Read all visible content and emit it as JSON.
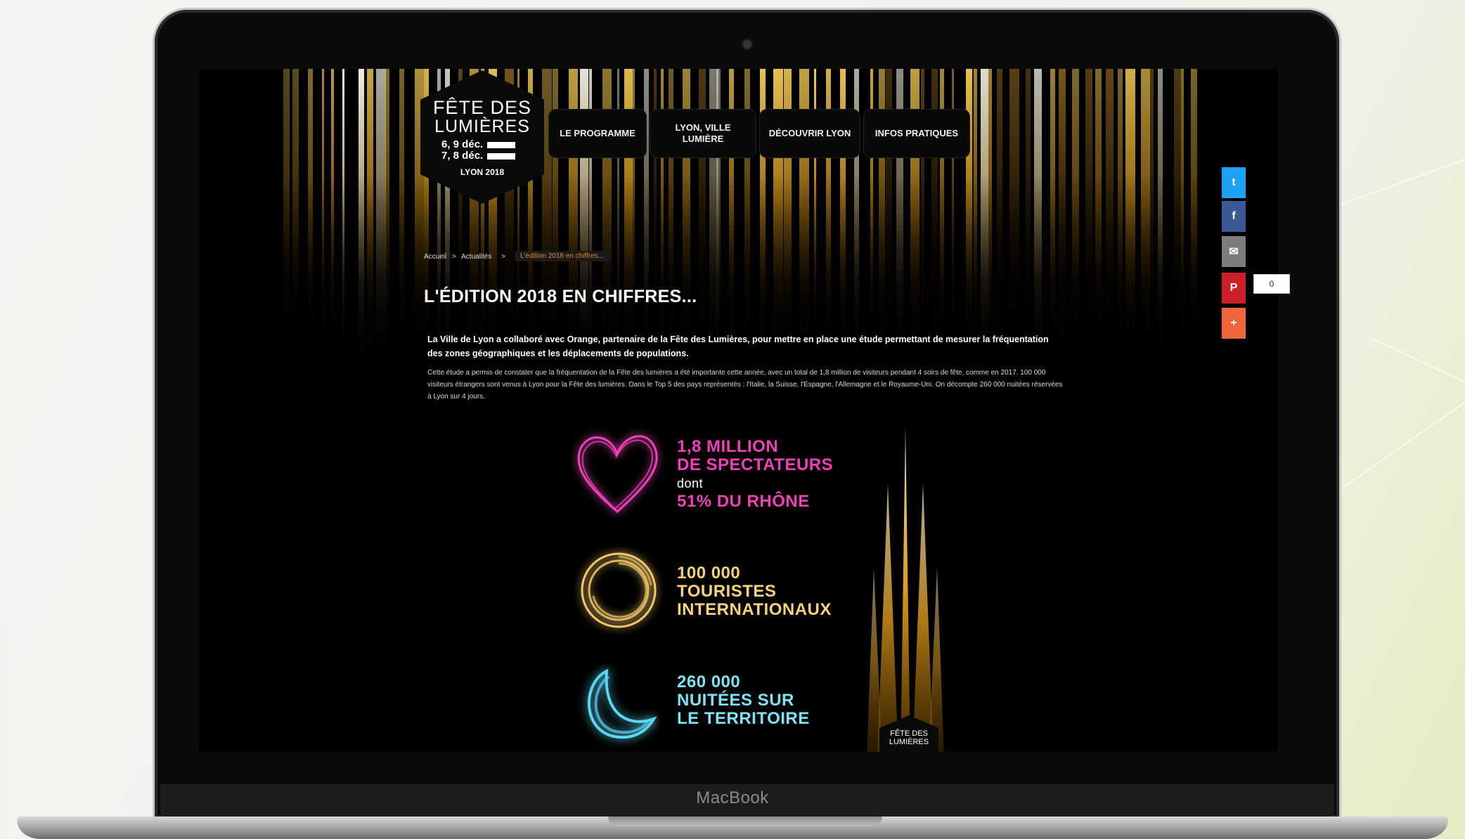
{
  "device": {
    "brand": "MacBook"
  },
  "logo": {
    "line1": "FÊTE DES",
    "line2": "LUMIÈRES",
    "dates1": "6, 9 déc.",
    "dates2": "7, 8 déc.",
    "city": "LYON 2018",
    "mini": "FÊTE DES LUMIÈRES"
  },
  "nav": {
    "items": [
      {
        "label": "LE PROGRAMME"
      },
      {
        "label": "LYON, VILLE LUMIÈRE"
      },
      {
        "label": "DÉCOUVRIR LYON"
      },
      {
        "label": "INFOS PRATIQUES"
      }
    ]
  },
  "breadcrumb": {
    "home": "Accueil",
    "sep1": ">",
    "section": "Actualités",
    "sep2": ">",
    "current": "L'édition 2018 en chiffres..."
  },
  "article": {
    "title": "L'ÉDITION 2018 EN CHIFFRES...",
    "lead": "La Ville de Lyon a collaboré avec Orange, partenaire de la Fête des Lumières, pour mettre en place une étude permettant de mesurer la fréquentation des zones géographiques et les déplacements de populations.",
    "body": "Cette étude a permis de constater que la fréquentation de la Fête des lumières a été importante cette année, avec un total de 1,8 million de visiteurs pendant 4 soirs de fête, comme en 2017. 100 000 visiteurs étrangers sont venus à Lyon pour la Fête des lumières. Dans le Top 5 des pays représentés : l'Italie, la Suisse, l'Espagne, l'Allemagne et le Royaume-Uni. On décompte 260 000 nuitées réservées à Lyon sur 4 jours."
  },
  "stats": [
    {
      "l1": "1,8 MILLION",
      "l2": "DE SPECTATEURS",
      "l3": "dont",
      "l4": "51% DU RHÔNE",
      "color": "#f040b8",
      "icon": "heart-icon"
    },
    {
      "l1": "100 000",
      "l2": "TOURISTES",
      "l3": "INTERNATIONAUX",
      "color": "#f7d27a",
      "icon": "swirl-icon"
    },
    {
      "l1": "260 000",
      "l2": "NUITÉES SUR",
      "l3": "LE TERRITOIRE",
      "color": "#7fe3f5",
      "icon": "moon-icon"
    }
  ],
  "share": {
    "count": "0",
    "buttons": [
      {
        "name": "twitter-icon",
        "glyph": "t",
        "color": "#1da1f2"
      },
      {
        "name": "facebook-icon",
        "glyph": "f",
        "color": "#3b5998"
      },
      {
        "name": "email-icon",
        "glyph": "✉",
        "color": "#7d7d7d"
      },
      {
        "name": "pinterest-icon",
        "glyph": "P",
        "color": "#cb2027"
      },
      {
        "name": "plus-icon",
        "glyph": "+",
        "color": "#f0643c"
      }
    ]
  }
}
